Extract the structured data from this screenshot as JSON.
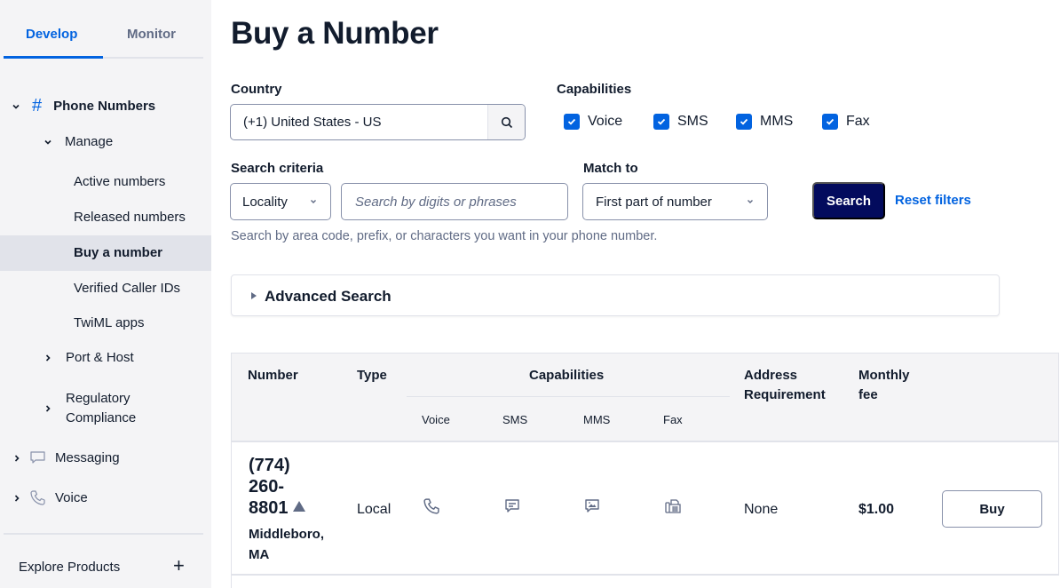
{
  "sidebar": {
    "tabs": [
      {
        "label": "Develop",
        "active": true
      },
      {
        "label": "Monitor",
        "active": false
      }
    ],
    "phone_numbers": {
      "label": "Phone Numbers",
      "icon": "hash-icon"
    },
    "manage": {
      "label": "Manage"
    },
    "manage_items": [
      {
        "label": "Active numbers"
      },
      {
        "label": "Released numbers"
      },
      {
        "label": "Buy a number",
        "active": true
      },
      {
        "label": "Verified Caller IDs"
      },
      {
        "label": "TwiML apps"
      }
    ],
    "port_host": {
      "label": "Port & Host"
    },
    "regulatory": {
      "label_line1": "Regulatory",
      "label_line2": "Compliance"
    },
    "messaging": {
      "label": "Messaging",
      "icon": "chat-bubble-icon"
    },
    "voice": {
      "label": "Voice",
      "icon": "phone-icon"
    },
    "explore": {
      "label": "Explore Products",
      "icon": "plus-icon"
    }
  },
  "page": {
    "title": "Buy a Number"
  },
  "filters": {
    "country_label": "Country",
    "country_value": "(+1) United States - US",
    "capabilities_label": "Capabilities",
    "capabilities": [
      {
        "label": "Voice",
        "checked": true
      },
      {
        "label": "SMS",
        "checked": true
      },
      {
        "label": "MMS",
        "checked": true
      },
      {
        "label": "Fax",
        "checked": true
      }
    ],
    "search_criteria_label": "Search criteria",
    "search_criteria_value": "Locality",
    "search_placeholder": "Search by digits or phrases",
    "match_to_label": "Match to",
    "match_to_value": "First part of number",
    "search_button": "Search",
    "reset_link": "Reset filters",
    "help_text": "Search by area code, prefix, or characters you want in your phone number."
  },
  "advanced_search": {
    "label": "Advanced Search",
    "expanded": false
  },
  "table": {
    "headers": {
      "number": "Number",
      "type": "Type",
      "capabilities": "Capabilities",
      "capabilities_sub": [
        "Voice",
        "SMS",
        "MMS",
        "Fax"
      ],
      "address_line1": "Address",
      "address_line2": "Requirement",
      "fee_line1": "Monthly",
      "fee_line2": "fee"
    },
    "rows": [
      {
        "number_line1": "(774)",
        "number_line2": "260-",
        "number_line3": "8801",
        "location_line1": "Middleboro,",
        "location_line2": "MA",
        "type": "Local",
        "capabilities": [
          "phone-icon",
          "sms-icon",
          "mms-icon",
          "fax-icon"
        ],
        "address_requirement": "None",
        "monthly_fee": "$1.00",
        "action": "Buy"
      }
    ]
  },
  "colors": {
    "accent": "#0263e0",
    "primary_button": "#030b5d",
    "text": "#121c2d",
    "muted": "#606b85",
    "sidebar_bg": "#f4f4f6"
  }
}
